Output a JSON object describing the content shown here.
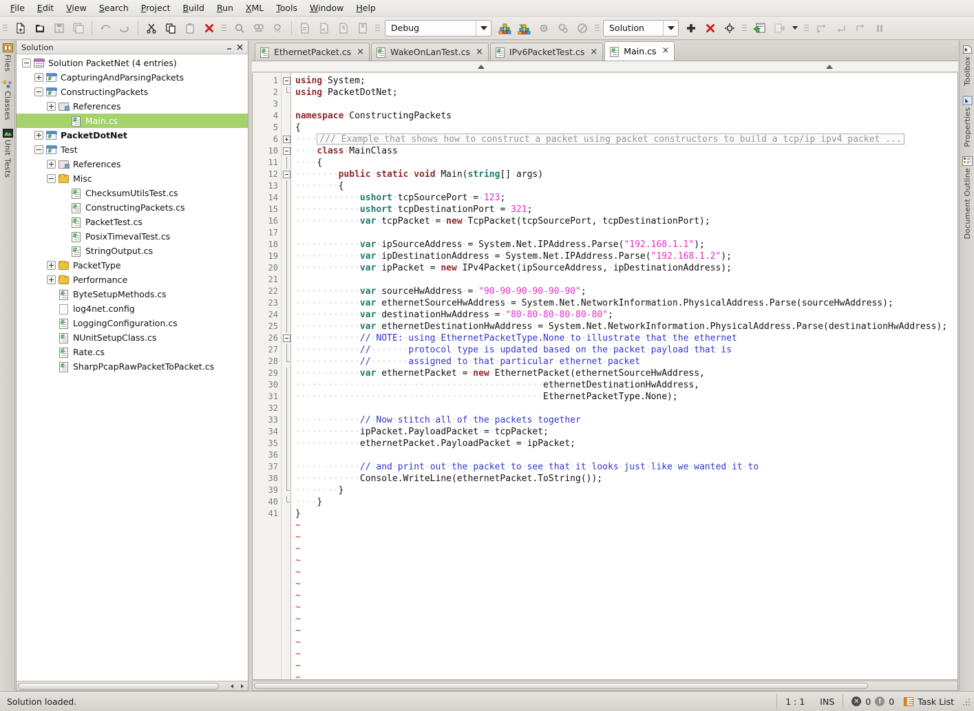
{
  "menubar": {
    "items": [
      {
        "label": "File",
        "mnemonic": "F"
      },
      {
        "label": "Edit",
        "mnemonic": "E"
      },
      {
        "label": "View",
        "mnemonic": "V"
      },
      {
        "label": "Search",
        "mnemonic": "S"
      },
      {
        "label": "Project",
        "mnemonic": "P"
      },
      {
        "label": "Build",
        "mnemonic": "B"
      },
      {
        "label": "Run",
        "mnemonic": "R"
      },
      {
        "label": "XML",
        "mnemonic": "X"
      },
      {
        "label": "Tools",
        "mnemonic": "T"
      },
      {
        "label": "Window",
        "mnemonic": "W"
      },
      {
        "label": "Help",
        "mnemonic": "H"
      }
    ]
  },
  "toolbar": {
    "buttons": [
      "new-file-icon",
      "new-solution-icon",
      "save-icon",
      "save-all-icon",
      "undo-icon",
      "redo-icon",
      "cut-icon",
      "copy-icon",
      "paste-icon",
      "delete-icon",
      "find-icon",
      "find-in-files-icon",
      "find-next-icon",
      "comment-icon",
      "uncomment-icon",
      "toggle-bookmark-icon",
      "bookmark-icon"
    ],
    "configuration_combo": {
      "value": "Debug",
      "name": "configuration-selector"
    },
    "build_buttons": [
      "build-icon",
      "rebuild-icon",
      "build-settings-icon",
      "clean-icon",
      "stop-build-icon"
    ],
    "run_target_combo": {
      "value": "Solution",
      "name": "run-target-selector"
    },
    "debug_buttons": [
      "add-icon",
      "remove-icon",
      "navigate-icon"
    ],
    "exec_buttons": [
      "run-icon",
      "run-with-icon"
    ],
    "step_buttons": [
      "step-over-icon",
      "step-into-icon",
      "step-out-icon",
      "pause-icon"
    ]
  },
  "left_dock": {
    "tabs": [
      {
        "label": "Files",
        "icon": "files-icon"
      },
      {
        "label": "Classes",
        "icon": "classes-icon"
      },
      {
        "label": "Unit Tests",
        "icon": "unit-tests-icon"
      }
    ]
  },
  "right_dock": {
    "tabs": [
      {
        "label": "Toolbox",
        "icon": "toolbox-icon"
      },
      {
        "label": "Properties",
        "icon": "properties-icon"
      },
      {
        "label": "Document Outline",
        "icon": "document-outline-icon"
      }
    ]
  },
  "solution_pad": {
    "title": "Solution",
    "minimize_label": "_",
    "close_label": "×",
    "tree": [
      {
        "indent": 0,
        "expander": "minus",
        "icon": "solution-icon",
        "label": "Solution PacketNet (4 entries)",
        "bold": false,
        "selected": false
      },
      {
        "indent": 1,
        "expander": "plus",
        "icon": "project-icon",
        "label": "CapturingAndParsingPackets",
        "bold": false,
        "selected": false
      },
      {
        "indent": 1,
        "expander": "minus",
        "icon": "project-icon",
        "label": "ConstructingPackets",
        "bold": false,
        "selected": false
      },
      {
        "indent": 2,
        "expander": "plus",
        "icon": "references-icon",
        "label": "References",
        "bold": false,
        "selected": false
      },
      {
        "indent": 3,
        "expander": "none",
        "icon": "csharp-file-icon",
        "label": "Main.cs",
        "bold": false,
        "selected": true
      },
      {
        "indent": 1,
        "expander": "plus",
        "icon": "project-icon",
        "label": "PacketDotNet",
        "bold": true,
        "selected": false
      },
      {
        "indent": 1,
        "expander": "minus",
        "icon": "project-icon",
        "label": "Test",
        "bold": false,
        "selected": false
      },
      {
        "indent": 2,
        "expander": "plus",
        "icon": "references-icon",
        "label": "References",
        "bold": false,
        "selected": false
      },
      {
        "indent": 2,
        "expander": "minus",
        "icon": "folder-icon",
        "label": "Misc",
        "bold": false,
        "selected": false
      },
      {
        "indent": 3,
        "expander": "none",
        "icon": "csharp-file-icon",
        "label": "ChecksumUtilsTest.cs",
        "bold": false,
        "selected": false
      },
      {
        "indent": 3,
        "expander": "none",
        "icon": "csharp-file-icon",
        "label": "ConstructingPackets.cs",
        "bold": false,
        "selected": false
      },
      {
        "indent": 3,
        "expander": "none",
        "icon": "csharp-file-icon",
        "label": "PacketTest.cs",
        "bold": false,
        "selected": false
      },
      {
        "indent": 3,
        "expander": "none",
        "icon": "csharp-file-icon",
        "label": "PosixTimevalTest.cs",
        "bold": false,
        "selected": false
      },
      {
        "indent": 3,
        "expander": "none",
        "icon": "csharp-file-icon",
        "label": "StringOutput.cs",
        "bold": false,
        "selected": false
      },
      {
        "indent": 2,
        "expander": "plus",
        "icon": "folder-icon",
        "label": "PacketType",
        "bold": false,
        "selected": false
      },
      {
        "indent": 2,
        "expander": "plus",
        "icon": "folder-icon",
        "label": "Performance",
        "bold": false,
        "selected": false
      },
      {
        "indent": 2,
        "expander": "none",
        "icon": "csharp-file-icon",
        "label": "ByteSetupMethods.cs",
        "bold": false,
        "selected": false
      },
      {
        "indent": 2,
        "expander": "none",
        "icon": "plain-file-icon",
        "label": "log4net.config",
        "bold": false,
        "selected": false
      },
      {
        "indent": 2,
        "expander": "none",
        "icon": "csharp-file-icon",
        "label": "LoggingConfiguration.cs",
        "bold": false,
        "selected": false
      },
      {
        "indent": 2,
        "expander": "none",
        "icon": "csharp-file-icon",
        "label": "NUnitSetupClass.cs",
        "bold": false,
        "selected": false
      },
      {
        "indent": 2,
        "expander": "none",
        "icon": "csharp-file-icon",
        "label": "Rate.cs",
        "bold": false,
        "selected": false
      },
      {
        "indent": 2,
        "expander": "none",
        "icon": "csharp-file-icon",
        "label": "SharpPcapRawPacketToPacket.cs",
        "bold": false,
        "selected": false
      }
    ]
  },
  "editor": {
    "tabs": [
      {
        "label": "EthernetPacket.cs",
        "active": false,
        "close": "×",
        "icon": "csharp-file-icon"
      },
      {
        "label": "WakeOnLanTest.cs",
        "active": false,
        "close": "×",
        "icon": "csharp-file-icon"
      },
      {
        "label": "IPv6PacketTest.cs",
        "active": false,
        "close": "×",
        "icon": "csharp-file-icon"
      },
      {
        "label": "Main.cs",
        "active": true,
        "close": "×",
        "icon": "csharp-file-icon"
      }
    ],
    "fold_marker_collapsed": "...",
    "lines": [
      {
        "n": "1",
        "fold": "start",
        "html": "<span class=\"kw\">using</span><span class=\"ws\">·</span>System;"
      },
      {
        "n": "2",
        "fold": "end",
        "html": "<span class=\"kw\">using</span><span class=\"ws\">·</span>PacketDotNet;"
      },
      {
        "n": "3",
        "fold": "",
        "html": ""
      },
      {
        "n": "4",
        "fold": "",
        "html": "<span class=\"kw\">namespace</span><span class=\"ws\">·</span>ConstructingPackets"
      },
      {
        "n": "5",
        "fold": "",
        "html": "{"
      },
      {
        "n": "6",
        "fold": "plus",
        "html": "<span class=\"ws\">····</span><span class=\"fold-text\">/// Example that shows how to construct a packet using packet constructors to build a tcp/ip ipv4 packet ...</span>"
      },
      {
        "n": "10",
        "fold": "minus",
        "html": "<span class=\"ws\">····</span><span class=\"kw\">class</span><span class=\"ws\">·</span>MainClass"
      },
      {
        "n": "11",
        "fold": "bar",
        "html": "<span class=\"ws\">····</span>{"
      },
      {
        "n": "12",
        "fold": "minus",
        "html": "<span class=\"ws\">········</span><span class=\"kw\">public</span><span class=\"ws\">·</span><span class=\"kw\">static</span><span class=\"ws\">·</span><span class=\"kw\">void</span><span class=\"ws\">·</span>Main(<span class=\"kw2\">string</span>[]<span class=\"ws\">·</span>args)"
      },
      {
        "n": "13",
        "fold": "bar",
        "html": "<span class=\"ws\">········</span>{"
      },
      {
        "n": "14",
        "fold": "bar",
        "html": "<span class=\"ws\">············</span><span class=\"kw2\">ushort</span><span class=\"ws\">·</span>tcpSourcePort<span class=\"ws\">·</span>=<span class=\"ws\">·</span><span class=\"num\">123</span>;"
      },
      {
        "n": "15",
        "fold": "bar",
        "html": "<span class=\"ws\">············</span><span class=\"kw2\">ushort</span><span class=\"ws\">·</span>tcpDestinationPort<span class=\"ws\">·</span>=<span class=\"ws\">·</span><span class=\"num\">321</span>;"
      },
      {
        "n": "16",
        "fold": "bar",
        "html": "<span class=\"ws\">············</span><span class=\"kw2\">var</span><span class=\"ws\">·</span>tcpPacket<span class=\"ws\">·</span>=<span class=\"ws\">·</span><span class=\"kw\">new</span><span class=\"ws\">·</span>TcpPacket(tcpSourcePort,<span class=\"ws\">·</span>tcpDestinationPort);"
      },
      {
        "n": "17",
        "fold": "bar",
        "html": ""
      },
      {
        "n": "18",
        "fold": "bar",
        "html": "<span class=\"ws\">············</span><span class=\"kw2\">var</span><span class=\"ws\">·</span>ipSourceAddress<span class=\"ws\">·</span>=<span class=\"ws\">·</span>System.Net.IPAddress.Parse(<span class=\"str\">\"192.168.1.1\"</span>);"
      },
      {
        "n": "19",
        "fold": "bar",
        "html": "<span class=\"ws\">············</span><span class=\"kw2\">var</span><span class=\"ws\">·</span>ipDestinationAddress<span class=\"ws\">·</span>=<span class=\"ws\">·</span>System.Net.IPAddress.Parse(<span class=\"str\">\"192.168.1.2\"</span>);"
      },
      {
        "n": "20",
        "fold": "bar",
        "html": "<span class=\"ws\">············</span><span class=\"kw2\">var</span><span class=\"ws\">·</span>ipPacket<span class=\"ws\">·</span>=<span class=\"ws\">·</span><span class=\"kw\">new</span><span class=\"ws\">·</span>IPv4Packet(ipSourceAddress,<span class=\"ws\">·</span>ipDestinationAddress);"
      },
      {
        "n": "21",
        "fold": "bar",
        "html": ""
      },
      {
        "n": "22",
        "fold": "bar",
        "html": "<span class=\"ws\">············</span><span class=\"kw2\">var</span><span class=\"ws\">·</span>sourceHwAddress<span class=\"ws\">·</span>=<span class=\"ws\">·</span><span class=\"str\">\"90-90-90-90-90-90\"</span>;"
      },
      {
        "n": "23",
        "fold": "bar",
        "html": "<span class=\"ws\">············</span><span class=\"kw2\">var</span><span class=\"ws\">·</span>ethernetSourceHwAddress<span class=\"ws\">·</span>=<span class=\"ws\">·</span>System.Net.NetworkInformation.PhysicalAddress.Parse(sourceHwAddress);"
      },
      {
        "n": "24",
        "fold": "bar",
        "html": "<span class=\"ws\">············</span><span class=\"kw2\">var</span><span class=\"ws\">·</span>destinationHwAddress<span class=\"ws\">·</span>=<span class=\"ws\">·</span><span class=\"str\">\"80-80-80-80-80-80\"</span>;"
      },
      {
        "n": "25",
        "fold": "bar",
        "html": "<span class=\"ws\">············</span><span class=\"kw2\">var</span><span class=\"ws\">·</span>ethernetDestinationHwAddress<span class=\"ws\">·</span>=<span class=\"ws\">·</span>System.Net.NetworkInformation.PhysicalAddress.Parse(destinationHwAddress);"
      },
      {
        "n": "26",
        "fold": "minus",
        "html": "<span class=\"ws\">············</span><span class=\"cmt\">//<span class=\"ws\">·</span>NOTE:<span class=\"ws\">·</span>using<span class=\"ws\">·</span>EthernetPacketType.None<span class=\"ws\">·</span>to<span class=\"ws\">·</span>illustrate<span class=\"ws\">·</span>that<span class=\"ws\">·</span>the<span class=\"ws\">·</span>ethernet</span>"
      },
      {
        "n": "27",
        "fold": "bar",
        "html": "<span class=\"ws\">············</span><span class=\"cmt\">//<span class=\"ws\">·······</span>protocol<span class=\"ws\">·</span>type<span class=\"ws\">·</span>is<span class=\"ws\">·</span>updated<span class=\"ws\">·</span>based<span class=\"ws\">·</span>on<span class=\"ws\">·</span>the<span class=\"ws\">·</span>packet<span class=\"ws\">·</span>payload<span class=\"ws\">·</span>that<span class=\"ws\">·</span>is</span>"
      },
      {
        "n": "28",
        "fold": "endbar",
        "html": "<span class=\"ws\">············</span><span class=\"cmt\">//<span class=\"ws\">·······</span>assigned<span class=\"ws\">·</span>to<span class=\"ws\">·</span>that<span class=\"ws\">·</span>particular<span class=\"ws\">·</span>ethernet<span class=\"ws\">·</span>packet</span>"
      },
      {
        "n": "29",
        "fold": "bar",
        "html": "<span class=\"ws\">············</span><span class=\"kw2\">var</span><span class=\"ws\">·</span>ethernetPacket<span class=\"ws\">·</span>=<span class=\"ws\">·</span><span class=\"kw\">new</span><span class=\"ws\">·</span>EthernetPacket(ethernetSourceHwAddress,"
      },
      {
        "n": "30",
        "fold": "bar",
        "html": "<span class=\"ws\">··············································</span>ethernetDestinationHwAddress,"
      },
      {
        "n": "31",
        "fold": "bar",
        "html": "<span class=\"ws\">··············································</span>EthernetPacketType.None);"
      },
      {
        "n": "32",
        "fold": "bar",
        "html": ""
      },
      {
        "n": "33",
        "fold": "bar",
        "html": "<span class=\"ws\">············</span><span class=\"cmt\">//<span class=\"ws\">·</span>Now<span class=\"ws\">·</span>stitch<span class=\"ws\">·</span>all<span class=\"ws\">·</span>of<span class=\"ws\">·</span>the<span class=\"ws\">·</span>packets<span class=\"ws\">·</span>together</span>"
      },
      {
        "n": "34",
        "fold": "bar",
        "html": "<span class=\"ws\">············</span>ipPacket.PayloadPacket<span class=\"ws\">·</span>=<span class=\"ws\">·</span>tcpPacket;"
      },
      {
        "n": "35",
        "fold": "bar",
        "html": "<span class=\"ws\">············</span>ethernetPacket.PayloadPacket<span class=\"ws\">·</span>=<span class=\"ws\">·</span>ipPacket;"
      },
      {
        "n": "36",
        "fold": "bar",
        "html": ""
      },
      {
        "n": "37",
        "fold": "bar",
        "html": "<span class=\"ws\">············</span><span class=\"cmt\">//<span class=\"ws\">·</span>and<span class=\"ws\">·</span>print<span class=\"ws\">·</span>out<span class=\"ws\">·</span>the<span class=\"ws\">·</span>packet<span class=\"ws\">·</span>to<span class=\"ws\">·</span>see<span class=\"ws\">·</span>that<span class=\"ws\">·</span>it<span class=\"ws\">·</span>looks<span class=\"ws\">·</span>just<span class=\"ws\">·</span>like<span class=\"ws\">·</span>we<span class=\"ws\">·</span>wanted<span class=\"ws\">·</span>it<span class=\"ws\">·</span>to</span>"
      },
      {
        "n": "38",
        "fold": "bar",
        "html": "<span class=\"ws\">············</span>Console.WriteLine(ethernetPacket.ToString());"
      },
      {
        "n": "39",
        "fold": "endbar",
        "html": "<span class=\"ws\">········</span>}"
      },
      {
        "n": "40",
        "fold": "endbar",
        "html": "<span class=\"ws\">····</span>}"
      },
      {
        "n": "41",
        "fold": "",
        "html": "}"
      }
    ],
    "empty_line_marker": "~",
    "empty_line_count": 14
  },
  "statusbar": {
    "message": "Solution loaded.",
    "caret_position": "1 : 1",
    "insert_mode": "INS",
    "error_count": "0",
    "warning_count": "0",
    "task_list_label": "Task List"
  },
  "colors": {
    "selection_green": "#a5d26a",
    "keyword_red": "#8f2a2a",
    "type_teal": "#1d7a6e",
    "string_magenta": "#e22cc9",
    "comment_blue": "#3434cc",
    "tilde_red": "#cf2424"
  }
}
